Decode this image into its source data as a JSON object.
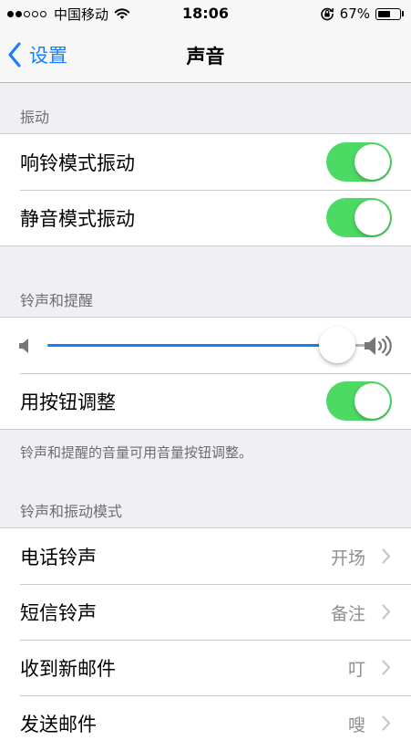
{
  "status_bar": {
    "signal_filled": 2,
    "signal_total": 5,
    "carrier": "中国移动",
    "time": "18:06",
    "battery_percent": "67%",
    "battery_level": 0.67
  },
  "nav": {
    "back_label": "设置",
    "title": "声音"
  },
  "vibration": {
    "header": "振动",
    "items": [
      {
        "label": "响铃模式振动",
        "on": true
      },
      {
        "label": "静音模式振动",
        "on": true
      }
    ]
  },
  "ringer": {
    "header": "铃声和提醒",
    "volume_level": 0.91,
    "adjust_label": "用按钮调整",
    "adjust_on": true,
    "note": "铃声和提醒的音量可用音量按钮调整。"
  },
  "patterns": {
    "header": "铃声和振动模式",
    "items": [
      {
        "label": "电话铃声",
        "value": "开场"
      },
      {
        "label": "短信铃声",
        "value": "备注"
      },
      {
        "label": "收到新邮件",
        "value": "叮"
      },
      {
        "label": "发送邮件",
        "value": "嗖"
      }
    ]
  },
  "colors": {
    "accent": "#157efb",
    "toggle_on": "#4cd964",
    "background": "#efeff4"
  },
  "icons": {
    "wifi": "wifi-icon",
    "rotation_lock": "rotation-lock-icon",
    "battery": "battery-icon",
    "back": "chevron-left-icon",
    "volume_low": "volume-low-icon",
    "volume_high": "volume-high-icon",
    "disclosure": "chevron-right-icon"
  }
}
